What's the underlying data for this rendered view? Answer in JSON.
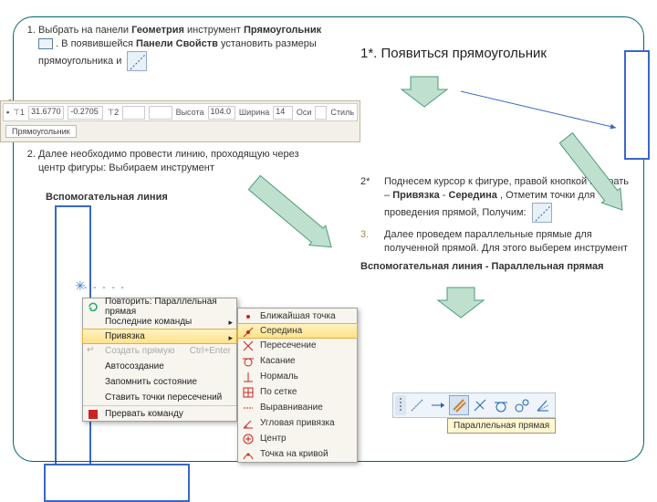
{
  "left": {
    "step1_a": "Выбрать на панели ",
    "step1_b": "Геометрия",
    "step1_c": " инструмент  ",
    "step1_d": "Прямоугольник",
    "step1_e": " .  В появившейся ",
    "step1_f": "Панели Свойств",
    "step1_g": " установить размеры прямоугольника и",
    "step2": "Далее необходимо провести линию, проходящую через центр фигуры: Выбираем инструмент",
    "aux": "Вспомогательная линия"
  },
  "prop": {
    "coord1": "31.6770",
    "coord2": "-0.2705",
    "h_label": "Высота",
    "h_val": "104.0",
    "w_label": "Ширина",
    "w_val": "14",
    "ax": "Оси",
    "style": "Стиль",
    "tab": "Прямоугольник"
  },
  "right": {
    "title": "1*. Появиться прямоугольник",
    "item2a": "Поднесем курсор к фигуре, правой кнопкой  выбрать – ",
    "item2b": "Привязка",
    "item2dash": "  -  ",
    "item2c": "Середина",
    "item2d": ", Отметим точки для проведения прямой, Получим:",
    "item2_num": "2*",
    "item3": "Далее проведем параллельные прямые для полученной прямой. Для этого выберем инструмент",
    "item3_num": "3.",
    "aux2": "Вспомогательная линия - Параллельная прямая"
  },
  "ctx": {
    "repeat": "Повторить: Параллельная прямая",
    "recent": "Последние команды",
    "snap": "Привязка",
    "create": "Создать прямую",
    "create_key": "Ctrl+Enter",
    "auto": "Автосоздание",
    "remember": "Запомнить состояние",
    "points": "Ставить точки пересечений",
    "cancel": "Прервать команду"
  },
  "sub": {
    "nearest": "Ближайшая точка",
    "mid": "Середина",
    "inter": "Пересечение",
    "tan": "Касание",
    "norm": "Нормаль",
    "grid": "По сетке",
    "align": "Выравнивание",
    "ang": "Угловая привязка",
    "center": "Центр",
    "curve": "Точка на кривой"
  },
  "tooltip": "Параллельная прямая"
}
